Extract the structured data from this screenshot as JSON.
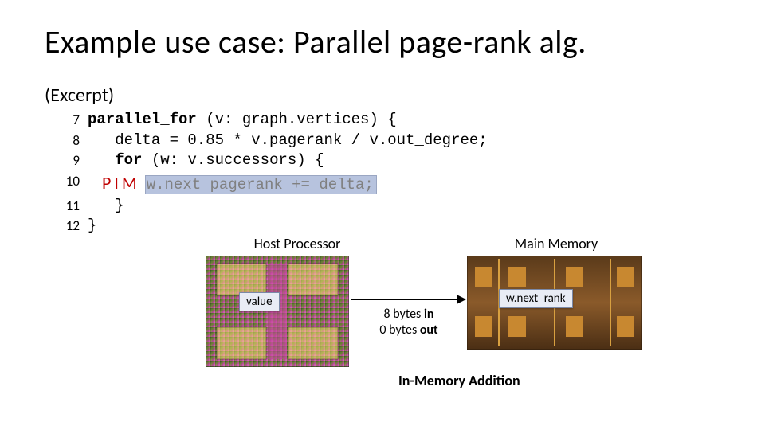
{
  "title": "Example use case: Parallel page-rank alg.",
  "excerpt": "(Excerpt)",
  "code": {
    "lines": [
      {
        "n": "7",
        "pre": "",
        "kw": "parallel_for",
        "post": " (v: graph.vertices) {"
      },
      {
        "n": "8",
        "pre": "   delta = 0.85 * v.pagerank / v.out_degree;",
        "kw": "",
        "post": ""
      },
      {
        "n": "9",
        "pre": "   ",
        "kw": "for",
        "post": " (w: v.successors) {"
      },
      {
        "n": "10",
        "pre": "",
        "kw": "",
        "post": ""
      },
      {
        "n": "11",
        "pre": "   }",
        "kw": "",
        "post": ""
      },
      {
        "n": "12",
        "pre": "}",
        "kw": "",
        "post": ""
      }
    ],
    "pim_label": "PIM",
    "highlight": "w.next_pagerank += delta;"
  },
  "diagram": {
    "host_title": "Host Processor",
    "mem_title": "Main Memory",
    "value_tag": "value",
    "rank_tag": "w.next_rank",
    "mid_line1_a": "8 bytes ",
    "mid_line1_b": "in",
    "mid_line2_a": "0 bytes ",
    "mid_line2_b": "out",
    "footer": "In-Memory Addition"
  }
}
